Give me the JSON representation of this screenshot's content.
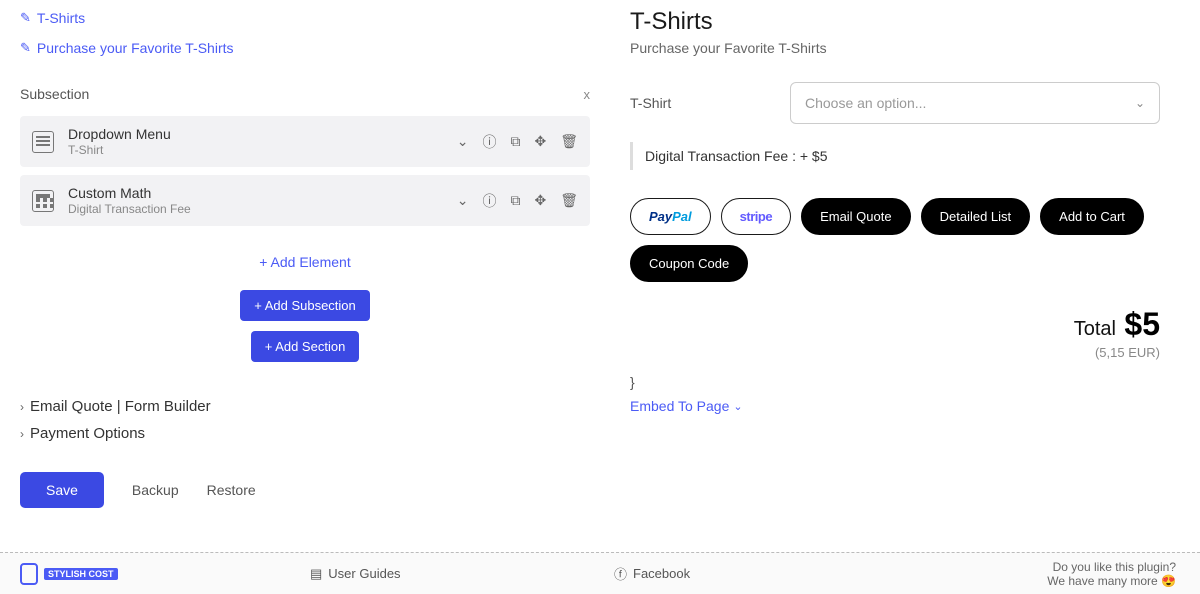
{
  "editor": {
    "title_text": "T-Shirts",
    "subtitle_text": "Purchase your Favorite T-Shirts",
    "subsection_label": "Subsection",
    "subsection_close": "x",
    "elements": [
      {
        "title": "Dropdown Menu",
        "sub": "T-Shirt"
      },
      {
        "title": "Custom Math",
        "sub": "Digital Transaction Fee"
      }
    ],
    "add_element": "+ Add Element",
    "add_subsection": "+ Add Subsection",
    "add_section": "+ Add Section",
    "accordions": {
      "email_quote": "Email Quote | Form Builder",
      "payment_options": "Payment Options"
    },
    "buttons": {
      "save": "Save",
      "backup": "Backup",
      "restore": "Restore"
    }
  },
  "preview": {
    "title": "T-Shirts",
    "subtitle": "Purchase your Favorite T-Shirts",
    "field_label": "T-Shirt",
    "select_placeholder": "Choose an option...",
    "fee_line": "Digital Transaction Fee : + $5",
    "actions": {
      "paypal": "PayPal",
      "stripe": "stripe",
      "email_quote": "Email Quote",
      "detailed_list": "Detailed List",
      "add_to_cart": "Add to Cart",
      "coupon_code": "Coupon Code"
    },
    "total_label": "Total",
    "total_value": "$5",
    "total_eur": "(5,15 EUR)",
    "brace": "}",
    "embed_label": "Embed To Page"
  },
  "footer": {
    "badge": "STYLISH COST",
    "user_guides": "User Guides",
    "facebook": "Facebook",
    "cta1": "Do you like this plugin?",
    "cta2": "We have many more 😍"
  }
}
